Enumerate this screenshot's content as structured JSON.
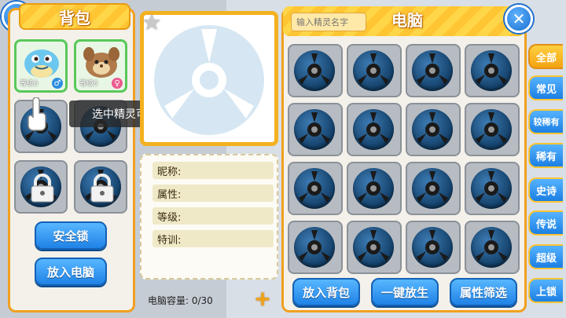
{
  "bag": {
    "title": "背包",
    "pets": [
      {
        "level_label": "等级5",
        "gender": "male"
      },
      {
        "level_label": "等级5",
        "gender": "female"
      }
    ],
    "safety_lock_label": "安全锁",
    "put_in_pc_label": "放入电脑"
  },
  "tooltip": {
    "text": "选中精灵可以查看信息"
  },
  "detail": {
    "fields": [
      "昵称:",
      "属性:",
      "等级:",
      "特训:"
    ],
    "capacity_label": "电脑容量: 0/30"
  },
  "pc": {
    "title": "电脑",
    "search_placeholder": "输入精灵名字",
    "put_in_bag_label": "放入背包",
    "release_all_label": "一键放生",
    "attr_filter_label": "属性筛选"
  },
  "tabs": [
    "全部",
    "常见",
    "较稀有",
    "稀有",
    "史诗",
    "传说",
    "超级",
    "上锁"
  ],
  "colors": {
    "accent": "#f0a020",
    "button_blue": "#1f82e6",
    "tab_active": "#f3a312"
  }
}
